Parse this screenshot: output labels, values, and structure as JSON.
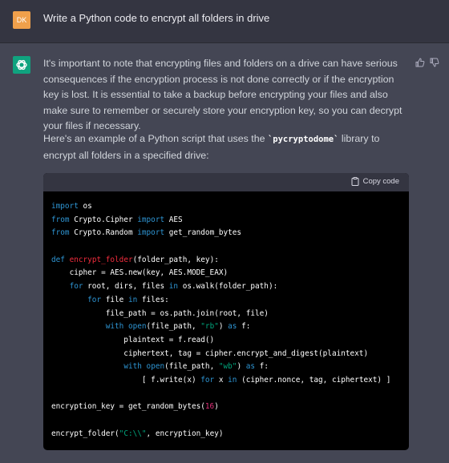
{
  "user": {
    "avatar_initials": "DK",
    "message": "Write a Python code to encrypt all folders in drive"
  },
  "assistant": {
    "paragraph_1": "It's important to note that encrypting files and folders on a drive can have serious consequences if the encryption process is not done correctly or if the encryption key is lost. It is essential to take a backup before encrypting your files and also make sure to remember or securely store your encryption key, so you can decrypt your files if necessary.",
    "paragraph_2_before": "Here's an example of a Python script that uses the ",
    "paragraph_2_code": "`pycryptodome`",
    "paragraph_2_after": " library to encrypt all folders in a specified drive:",
    "copy_label": "Copy code"
  },
  "code_lines": [
    [
      [
        "kw",
        "import"
      ],
      [
        "t",
        " os"
      ]
    ],
    [
      [
        "kw",
        "from"
      ],
      [
        "t",
        " Crypto.Cipher "
      ],
      [
        "kw",
        "import"
      ],
      [
        "t",
        " AES"
      ]
    ],
    [
      [
        "kw",
        "from"
      ],
      [
        "t",
        " Crypto.Random "
      ],
      [
        "kw",
        "import"
      ],
      [
        "t",
        " get_random_bytes"
      ]
    ],
    [],
    [
      [
        "kw",
        "def"
      ],
      [
        "t",
        " "
      ],
      [
        "fn",
        "encrypt_folder"
      ],
      [
        "t",
        "(folder_path, key):"
      ]
    ],
    [
      [
        "t",
        "    cipher = AES.new(key, AES.MODE_EAX)"
      ]
    ],
    [
      [
        "t",
        "    "
      ],
      [
        "kw",
        "for"
      ],
      [
        "t",
        " root, dirs, files "
      ],
      [
        "kw",
        "in"
      ],
      [
        "t",
        " os.walk(folder_path):"
      ]
    ],
    [
      [
        "t",
        "        "
      ],
      [
        "kw",
        "for"
      ],
      [
        "t",
        " file "
      ],
      [
        "kw",
        "in"
      ],
      [
        "t",
        " files:"
      ]
    ],
    [
      [
        "t",
        "            file_path = os.path.join(root, file)"
      ]
    ],
    [
      [
        "t",
        "            "
      ],
      [
        "kw",
        "with"
      ],
      [
        "t",
        " "
      ],
      [
        "kw",
        "open"
      ],
      [
        "t",
        "(file_path, "
      ],
      [
        "st",
        "\"rb\""
      ],
      [
        "t",
        ") "
      ],
      [
        "kw",
        "as"
      ],
      [
        "t",
        " f:"
      ]
    ],
    [
      [
        "t",
        "                plaintext = f.read()"
      ]
    ],
    [
      [
        "t",
        "                ciphertext, tag = cipher.encrypt_and_digest(plaintext)"
      ]
    ],
    [
      [
        "t",
        "                "
      ],
      [
        "kw",
        "with"
      ],
      [
        "t",
        " "
      ],
      [
        "kw",
        "open"
      ],
      [
        "t",
        "(file_path, "
      ],
      [
        "st",
        "\"wb\""
      ],
      [
        "t",
        ") "
      ],
      [
        "kw",
        "as"
      ],
      [
        "t",
        " f:"
      ]
    ],
    [
      [
        "t",
        "                    [ f.write(x) "
      ],
      [
        "kw",
        "for"
      ],
      [
        "t",
        " x "
      ],
      [
        "kw",
        "in"
      ],
      [
        "t",
        " (cipher.nonce, tag, ciphertext) ]"
      ]
    ],
    [],
    [
      [
        "t",
        "encryption_key = get_random_bytes("
      ],
      [
        "num",
        "16"
      ],
      [
        "t",
        ")"
      ]
    ],
    [],
    [
      [
        "t",
        "encrypt_folder("
      ],
      [
        "st",
        "\"C:\\\\\""
      ],
      [
        "t",
        ", encryption_key)"
      ]
    ]
  ]
}
